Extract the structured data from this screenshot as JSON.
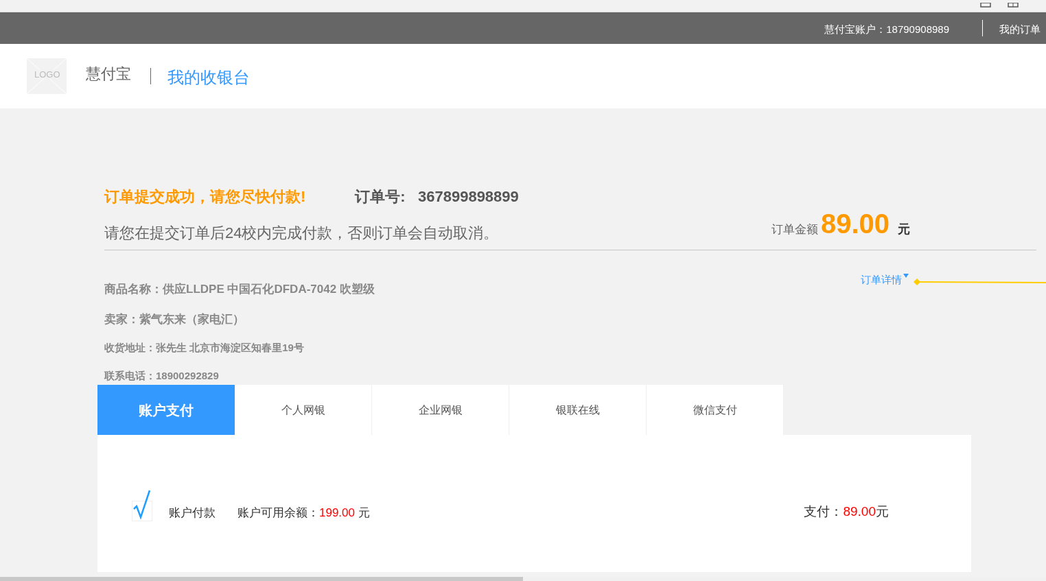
{
  "top_bar": {
    "account_label": "慧付宝账户：",
    "account_number": "18790908989",
    "orders_link": "我的订单"
  },
  "header": {
    "logo": "LOGO",
    "brand": "慧付宝",
    "page_title": "我的收银台"
  },
  "order": {
    "success_message": "订单提交成功，请您尽快付款!",
    "number_label": "订单号:",
    "number": "367899898899",
    "notice": "请您在提交订单后24校内完成付款，否则订单会自动取消。",
    "amount_label": "订单金额",
    "amount": "89.00",
    "currency": "元",
    "details_link": "订单详情"
  },
  "details": [
    {
      "text": "商品名称：供应LLDPE 中国石化DFDA-7042 吹塑级",
      "kind": "large"
    },
    {
      "text": "卖家：紫气东来（家电汇）",
      "kind": "large"
    },
    {
      "text": "收货地址：张先生 北京市海淀区知春里19号",
      "kind": "small"
    },
    {
      "text": "联系电话：18900292829",
      "kind": "small"
    }
  ],
  "tabs": [
    {
      "label": "账户支付",
      "selected": true
    },
    {
      "label": "个人网银",
      "selected": false
    },
    {
      "label": "企业网银",
      "selected": false
    },
    {
      "label": "银联在线",
      "selected": false
    },
    {
      "label": "微信支付",
      "selected": false
    }
  ],
  "payment": {
    "checked": true,
    "method": "账户付款",
    "balance_label": "账户可用余额：",
    "balance": "199.00",
    "balance_unit": "元",
    "pay_label": "支付：",
    "pay_amount": "89.00",
    "pay_unit": "元"
  }
}
